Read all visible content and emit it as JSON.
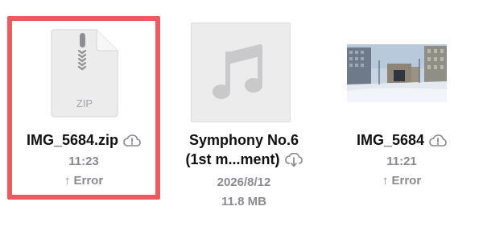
{
  "files": [
    {
      "name": "IMG_5684.zip",
      "type_badge": "ZIP",
      "time": "11:23",
      "status": "↑ Error",
      "icon": "zip-file-icon",
      "cloud_icon": "cloud-alert-icon"
    },
    {
      "name_line1": "Symphony No.6",
      "name_line2": "(1st m...ment)",
      "date": "2026/8/12",
      "size": "11.8 MB",
      "icon": "music-note-icon",
      "cloud_icon": "cloud-download-icon"
    },
    {
      "name": "IMG_5684",
      "time": "11:21",
      "status": "↑ Error",
      "icon": "image-thumbnail",
      "cloud_icon": "cloud-alert-icon"
    }
  ],
  "colors": {
    "selection": "#ee5a5e",
    "text": "#111111",
    "secondary": "#8a8a8f"
  }
}
